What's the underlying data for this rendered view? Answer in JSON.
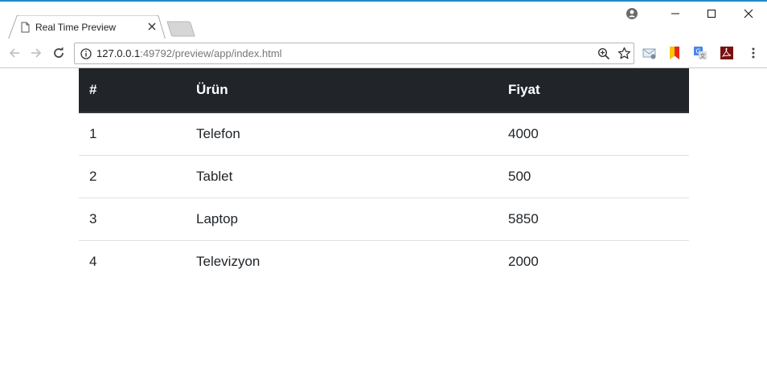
{
  "browser": {
    "tab": {
      "title": "Real Time Preview"
    },
    "address_bar": {
      "url_host": "127.0.0.1",
      "url_rest": ":49792/preview/app/index.html"
    }
  },
  "table": {
    "headers": [
      "#",
      "Ürün",
      "Fiyat"
    ],
    "rows": [
      [
        "1",
        "Telefon",
        "4000"
      ],
      [
        "2",
        "Tablet",
        "500"
      ],
      [
        "3",
        "Laptop",
        "5850"
      ],
      [
        "4",
        "Televizyon",
        "2000"
      ]
    ]
  },
  "colors": {
    "table_header_bg": "#212529",
    "table_header_text": "#ffffff",
    "row_divider": "#dee2e6"
  },
  "icons": [
    "document-icon",
    "close-icon",
    "profile-icon",
    "minimize-icon",
    "maximize-icon",
    "close-window-icon",
    "back-icon",
    "forward-icon",
    "reload-icon",
    "info-icon",
    "zoom-icon",
    "star-icon",
    "mail-icon",
    "bookmark-icon",
    "translate-icon",
    "pdf-icon",
    "menu-icon"
  ]
}
